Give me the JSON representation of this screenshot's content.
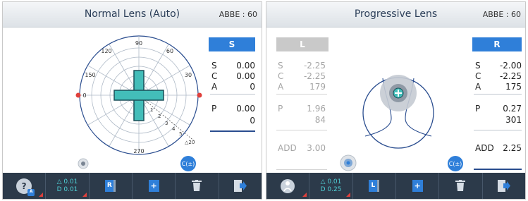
{
  "left_panel": {
    "title": "Normal Lens (Auto)",
    "abbe": "ABBE : 60",
    "angles": {
      "a90": "90",
      "a120": "120",
      "a60": "60",
      "a150": "150",
      "a30": "30",
      "a0": "0",
      "a270": "270"
    },
    "ring_labels": [
      "1",
      "2",
      "3",
      "4",
      "5",
      "△20"
    ],
    "side_label": "S",
    "measure": {
      "s_label": "S",
      "s_val": "0.00",
      "c_label": "C",
      "c_val": "0.00",
      "a_label": "A",
      "a_val": "0"
    },
    "prism": {
      "p_label": "P",
      "p_val1": "0.00",
      "p_val2": "0"
    },
    "c_button": "C(±)",
    "toolbar": {
      "help_label": "?",
      "delta_label": "△ 0.01",
      "d_label": "D 0.01",
      "r_label": "R",
      "plus_label": "+"
    }
  },
  "right_panel": {
    "title": "Progressive Lens",
    "abbe": "ABBE : 60",
    "left_lens": {
      "head": "L",
      "s_label": "S",
      "s_val": "-2.25",
      "c_label": "C",
      "c_val": "-2.25",
      "a_label": "A",
      "a_val": "179",
      "p_label": "P",
      "p_val1": "1.96",
      "p_val2": "84",
      "add_label": "ADD",
      "add_val": "3.00"
    },
    "right_lens": {
      "head": "R",
      "s_label": "S",
      "s_val": "-2.00",
      "c_label": "C",
      "c_val": "-2.25",
      "a_label": "A",
      "a_val": "175",
      "p_label": "P",
      "p_val1": "0.27",
      "p_val2": "301",
      "add_label": "ADD",
      "add_val": "2.25"
    },
    "c_button": "C(±)",
    "toolbar": {
      "delta_label": "△ 0.01",
      "d_label": "D 0.25",
      "l_label": "L",
      "plus_label": "+"
    }
  },
  "colors": {
    "accent": "#2f7fd9",
    "cyan": "#3bb8b9",
    "red": "#e0403c",
    "toolbar": "#2c3a4a"
  }
}
